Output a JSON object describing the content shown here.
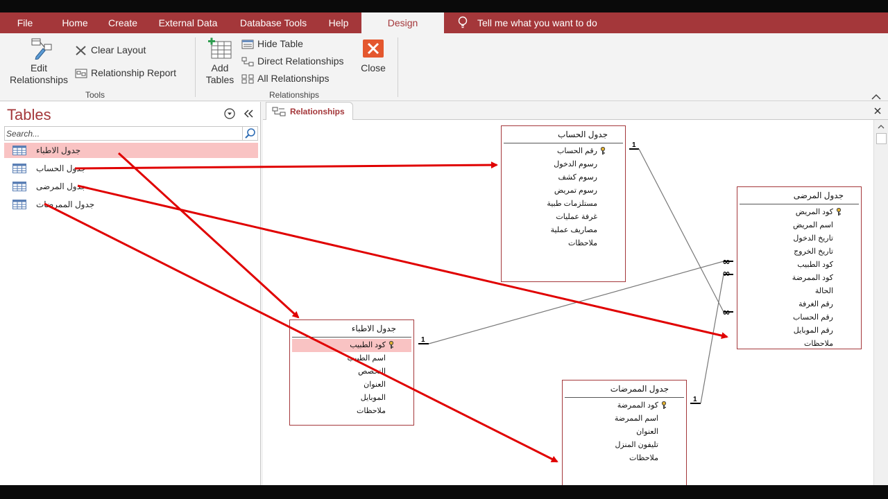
{
  "ribbon_tabs": [
    {
      "label": "File"
    },
    {
      "label": "Home"
    },
    {
      "label": "Create"
    },
    {
      "label": "External Data"
    },
    {
      "label": "Database Tools"
    },
    {
      "label": "Help"
    },
    {
      "label": "Design"
    }
  ],
  "tell_me": "Tell me what you want to do",
  "ribbon": {
    "edit_relationships_1": "Edit",
    "edit_relationships_2": "Relationships",
    "clear_layout": "Clear Layout",
    "relationship_report": "Relationship Report",
    "tools_group": "Tools",
    "add_tables_1": "Add",
    "add_tables_2": "Tables",
    "hide_table": "Hide Table",
    "direct_relationships": "Direct Relationships",
    "all_relationships": "All Relationships",
    "close": "Close",
    "relationships_group": "Relationships"
  },
  "nav": {
    "title": "Tables",
    "search_placeholder": "Search...",
    "items": [
      {
        "label": "جدول الاطباء"
      },
      {
        "label": "جدول الحساب"
      },
      {
        "label": "جدول المرضى"
      },
      {
        "label": "جدول الممرضات"
      }
    ]
  },
  "document_tab": "Relationships",
  "tables": {
    "accounts": {
      "title": "جدول الحساب",
      "fields": [
        "رقم الحساب",
        "رسوم الدخول",
        "رسوم كشف",
        "رسوم تمريض",
        "مستلزمات طبية",
        "غرفة عمليات",
        "مصاريف عملية",
        "ملاحظات"
      ]
    },
    "patients": {
      "title": "جدول المرضى",
      "fields": [
        "كود المريض",
        "اسم المريض",
        "تاريخ الدخول",
        "تاريخ الخروج",
        "كود الطبيب",
        "كود الممرضة",
        "الحالة",
        "رقم الغرفة",
        "رقم الحساب",
        "رقم الموبايل",
        "ملاحظات"
      ]
    },
    "doctors": {
      "title": "جدول الاطباء",
      "fields": [
        "كود الطبيب",
        "اسم الطبيب",
        "التخصص",
        "العنوان",
        "الموبايل",
        "ملاحظات"
      ]
    },
    "nurses": {
      "title": "جدول الممرضات",
      "fields": [
        "كود الممرضة",
        "اسم الممرضة",
        "العنوان",
        "تليفون المنزل",
        "ملاحظات"
      ]
    }
  },
  "relationships": {
    "one_label": "1",
    "many_label": "∞"
  },
  "colors": {
    "accent": "#a4373a",
    "annotation_arrow": "#e00000",
    "selection": "#f9c3c3"
  }
}
